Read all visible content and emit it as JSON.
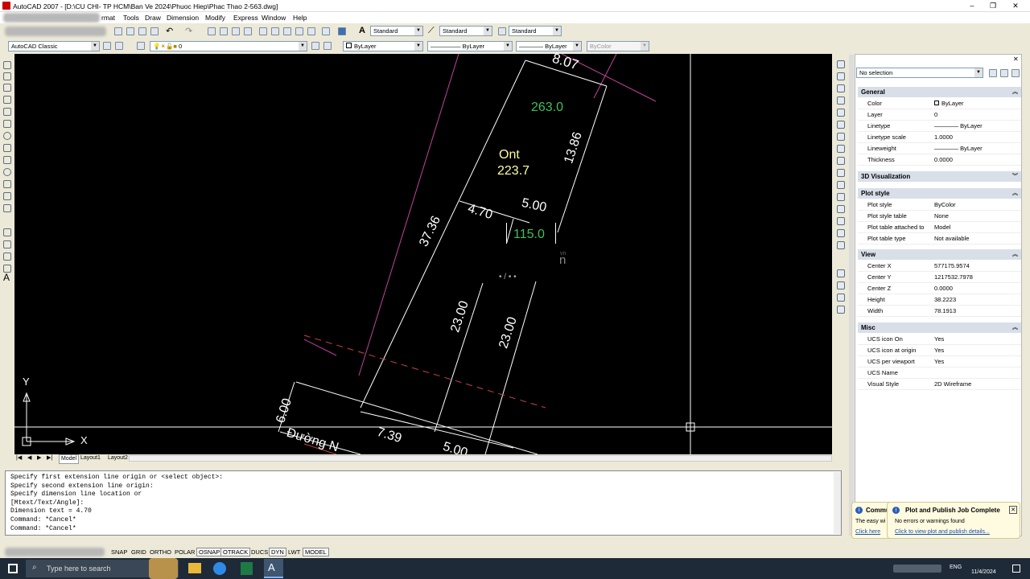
{
  "window": {
    "title": "AutoCAD 2007 - [D:\\CU CHI- TP HCM\\Ban Ve 2024\\Phuoc Hiep\\Phac Thao 2-563.dwg]"
  },
  "menu": [
    "rmat",
    "Tools",
    "Draw",
    "Dimension",
    "Modify",
    "Express",
    "Window",
    "Help"
  ],
  "toolbar": {
    "text_style": "Standard",
    "dim_style": "Standard",
    "table_style": "Standard",
    "workspace": "AutoCAD Classic",
    "layer": "0",
    "color": "ByLayer",
    "linetype": "ByLayer",
    "lineweight": "ByLayer",
    "plotstyle": "ByColor"
  },
  "drawing": {
    "top_width": "8.07",
    "area_green_1": "263.0",
    "land_code": "Ont",
    "area_ont": "223.7",
    "right_len": "13.86",
    "left_len": "37.36",
    "dim_470": "4.70",
    "dim_500": "5.00",
    "area_green_2": "115.0",
    "dim_2300_a": "23.00",
    "dim_2300_b": "23.00",
    "dim_600": "6.00",
    "dim_739": "7.39",
    "dim_500_b": "5.00",
    "road": "Đường N",
    "watermark_sub": "vn",
    "watermark": "n",
    "partial": "• / • •",
    "ucs_y": "Y",
    "ucs_x": "X"
  },
  "layout_tabs": [
    "Model",
    "Layout1",
    "Layout2"
  ],
  "command_lines": [
    "Specify first extension line origin or <select object>:",
    "Specify second extension line origin:",
    "Specify dimension line location or",
    "[Mtext/Text/Angle]:",
    "Dimension text = 4.70",
    "Command: *Cancel*",
    "Command: *Cancel*"
  ],
  "status_buttons": [
    "SNAP",
    "GRID",
    "ORTHO",
    "POLAR",
    "OSNAP",
    "OTRACK",
    "DUCS",
    "DYN",
    "LWT",
    "MODEL"
  ],
  "properties": {
    "selection": "No selection",
    "sections": [
      {
        "title": "General",
        "rows": [
          [
            "Color",
            "ByLayer"
          ],
          [
            "Layer",
            "0"
          ],
          [
            "Linetype",
            "ByLayer"
          ],
          [
            "Linetype scale",
            "1.0000"
          ],
          [
            "Lineweight",
            "ByLayer"
          ],
          [
            "Thickness",
            "0.0000"
          ]
        ]
      },
      {
        "title": "3D Visualization",
        "rows": []
      },
      {
        "title": "Plot style",
        "rows": [
          [
            "Plot style",
            "ByColor"
          ],
          [
            "Plot style table",
            "None"
          ],
          [
            "Plot table attached to",
            "Model"
          ],
          [
            "Plot table type",
            "Not available"
          ]
        ]
      },
      {
        "title": "View",
        "rows": [
          [
            "Center X",
            "577175.9574"
          ],
          [
            "Center Y",
            "1217532.7978"
          ],
          [
            "Center Z",
            "0.0000"
          ],
          [
            "Height",
            "38.2223"
          ],
          [
            "Width",
            "78.1913"
          ]
        ]
      },
      {
        "title": "Misc",
        "rows": [
          [
            "UCS icon On",
            "Yes"
          ],
          [
            "UCS icon at origin",
            "Yes"
          ],
          [
            "UCS per viewport",
            "Yes"
          ],
          [
            "UCS Name",
            ""
          ],
          [
            "Visual Style",
            "2D Wireframe"
          ]
        ]
      }
    ]
  },
  "notifications": {
    "back_title": "Commu",
    "back_line1": "The easy wi",
    "back_link": "Click here",
    "title": "Plot and Publish Job Complete",
    "message": "No errors or warnings found",
    "link": "Click to view plot and publish details..."
  },
  "taskbar": {
    "search_placeholder": "Type here to search",
    "date": "11/4/2024",
    "lang": "ENG"
  }
}
